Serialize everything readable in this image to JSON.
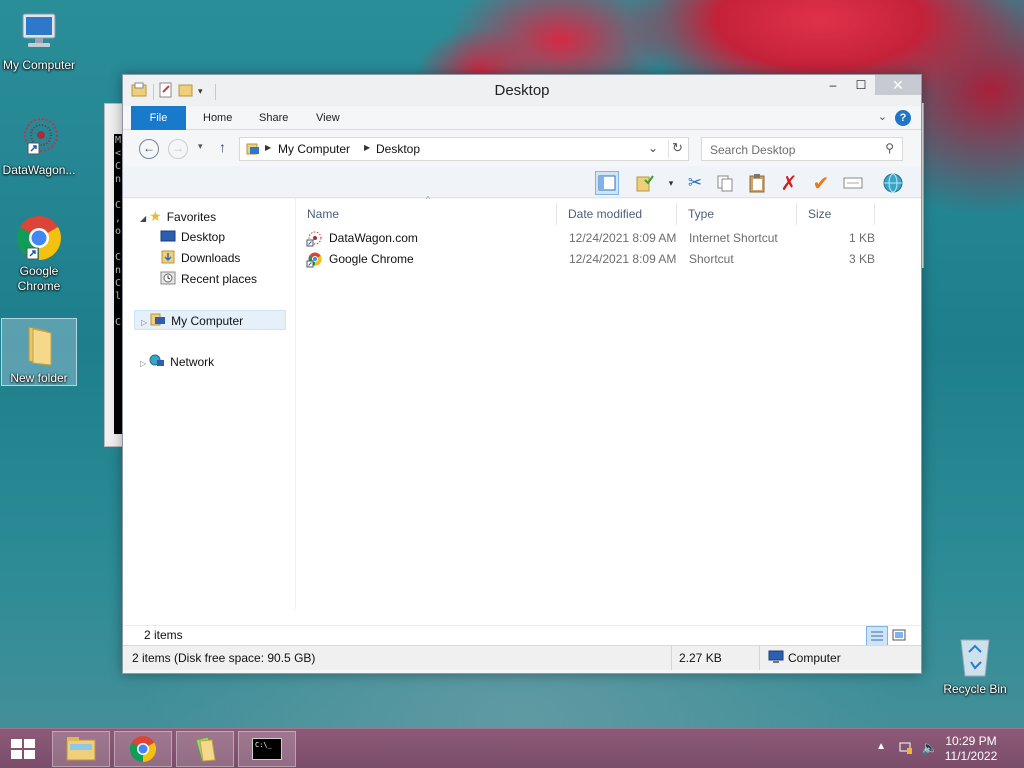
{
  "desktop": {
    "icons": [
      {
        "label": "My Computer"
      },
      {
        "label": "DataWagon..."
      },
      {
        "label": "Google Chrome"
      },
      {
        "label": "New folder"
      },
      {
        "label": "Recycle Bin"
      }
    ],
    "console_text": "M\n<\nC\nn\n\nC\n,\no\n\nC\nn\nC\nl\n\nC"
  },
  "window": {
    "title": "Desktop",
    "controls": {
      "minimize": "–",
      "maximize": "☐",
      "close": "✕"
    },
    "ribbon_tabs": [
      "File",
      "Home",
      "Share",
      "View"
    ],
    "help": "?",
    "address": {
      "crumbs": [
        "My Computer",
        "Desktop"
      ]
    },
    "search": {
      "placeholder": "Search Desktop"
    },
    "nav": {
      "favorites": "Favorites",
      "favorite_items": [
        "Desktop",
        "Downloads",
        "Recent places"
      ],
      "my_computer": "My Computer",
      "network": "Network"
    },
    "columns": [
      "Name",
      "Date modified",
      "Type",
      "Size"
    ],
    "files": [
      {
        "name": "DataWagon.com",
        "date": "12/24/2021 8:09 AM",
        "type": "Internet Shortcut",
        "size": "1 KB"
      },
      {
        "name": "Google Chrome",
        "date": "12/24/2021 8:09 AM",
        "type": "Shortcut",
        "size": "3 KB"
      }
    ],
    "item_count": "2 items",
    "status": {
      "left": "2 items (Disk free space: 90.5 GB)",
      "size": "2.27 KB",
      "location": "Computer"
    }
  },
  "taskbar": {
    "clock_time": "10:29 PM",
    "clock_date": "11/1/2022",
    "cmd_label": "C:\\_"
  },
  "colors": {
    "accent": "#1979ca",
    "taskbar": "#7a4d6a"
  }
}
